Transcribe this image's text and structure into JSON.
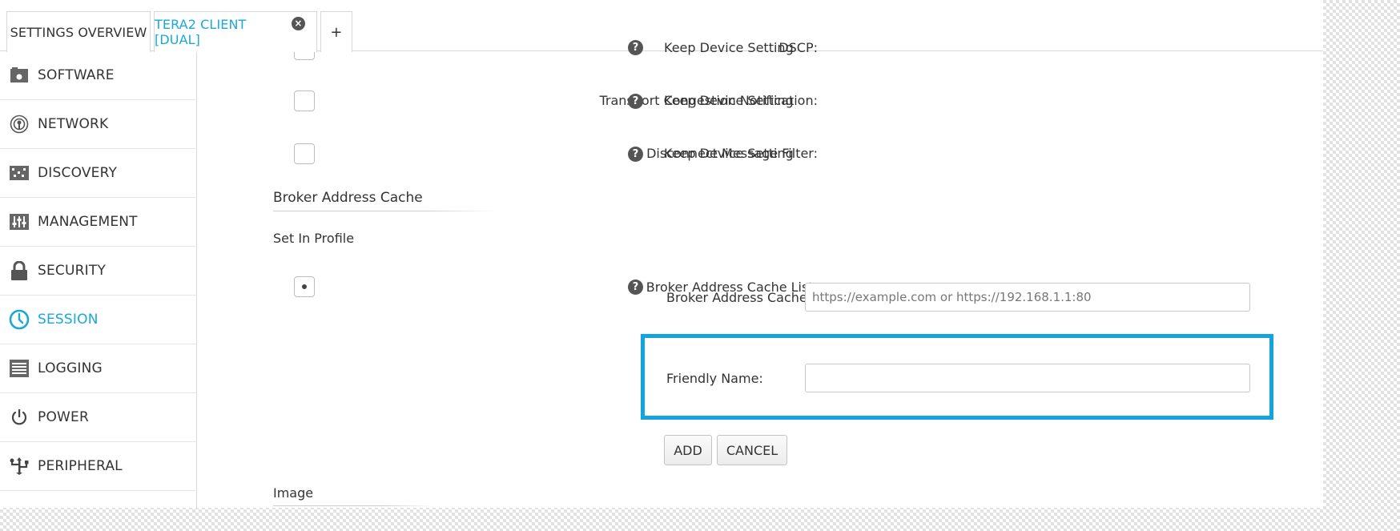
{
  "tabs": [
    {
      "label": "SETTINGS OVERVIEW"
    },
    {
      "label": "TERA2 CLIENT [DUAL]"
    },
    {
      "label": "+"
    }
  ],
  "sidebar": {
    "items": [
      {
        "label": "SOFTWARE",
        "icon": "software-icon"
      },
      {
        "label": "NETWORK",
        "icon": "network-icon"
      },
      {
        "label": "DISCOVERY",
        "icon": "discovery-icon"
      },
      {
        "label": "MANAGEMENT",
        "icon": "management-icon"
      },
      {
        "label": "SECURITY",
        "icon": "lock-icon"
      },
      {
        "label": "SESSION",
        "icon": "clock-icon"
      },
      {
        "label": "LOGGING",
        "icon": "logging-icon"
      },
      {
        "label": "POWER",
        "icon": "power-icon"
      },
      {
        "label": "PERIPHERAL",
        "icon": "usb-icon"
      }
    ],
    "active": "SESSION"
  },
  "content": {
    "rows": [
      {
        "label": "DSCP:",
        "value": "Keep Device Setting"
      },
      {
        "label": "Transport Congestion Notification:",
        "value": "Keep Device Setting"
      },
      {
        "label": "Disconnect Message Filter:",
        "value": "Keep Device Setting"
      }
    ],
    "help_glyph": "?",
    "broker_section": {
      "title": "Broker Address Cache",
      "subtitle": "Set In Profile",
      "list_label": "Broker Address Cache List:",
      "cache_label": "Broker Address Cache:",
      "cache_placeholder": "https://example.com or https://192.168.1.1:80",
      "cache_value": "",
      "friendly_label": "Friendly Name:",
      "friendly_value": "",
      "add_label": "ADD",
      "cancel_label": "CANCEL"
    },
    "image_section": {
      "title": "Image"
    }
  },
  "colors": {
    "accent": "#19a8dc",
    "highlight": "#13a3de"
  }
}
